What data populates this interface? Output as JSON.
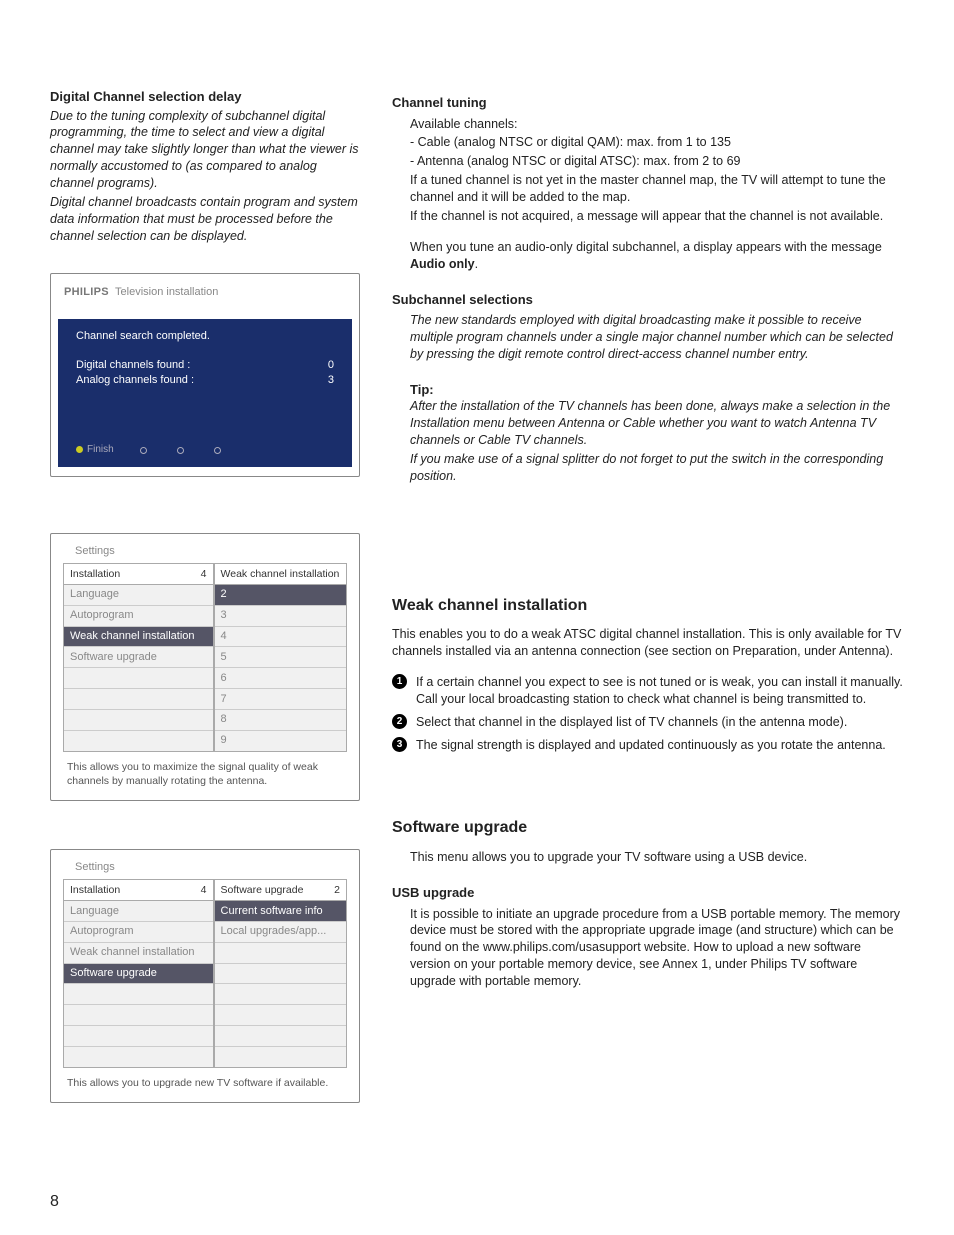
{
  "sidebar_note": {
    "title": "Digital Channel selection delay",
    "p1": "Due to the tuning complexity of subchannel digital programming, the time to select and view a digital channel may take slightly longer than what the viewer is normally accustomed to (as compared to analog channel programs).",
    "p2": "Digital channel broadcasts contain program and system data information that must be processed before the channel selection can be displayed."
  },
  "tv": {
    "brand_bold": "PHILIPS",
    "brand_rest": "Television installation",
    "msg": "Channel search completed.",
    "row1_lbl": "Digital channels found :",
    "row1_val": "0",
    "row2_lbl": "Analog channels found :",
    "row2_val": "3",
    "foot": "Finish"
  },
  "menu1": {
    "title": "Settings",
    "left_head": "Installation",
    "left_num": "4",
    "right_head": "Weak channel installation",
    "left_items": [
      "Language",
      "Autoprogram",
      "Weak channel installation",
      "Software upgrade",
      "",
      "",
      "",
      ""
    ],
    "left_sel_idx": 2,
    "right_items": [
      "2",
      "3",
      "4",
      "5",
      "6",
      "7",
      "8",
      "9"
    ],
    "right_sel_idx": 0,
    "hint": "This allows you to maximize the signal quality of weak channels by manually rotating the antenna."
  },
  "menu2": {
    "title": "Settings",
    "left_head": "Installation",
    "left_num": "4",
    "right_head": "Software upgrade",
    "right_num": "2",
    "left_items": [
      "Language",
      "Autoprogram",
      "Weak channel installation",
      "Software upgrade",
      "",
      "",
      "",
      ""
    ],
    "left_sel_idx": 3,
    "right_items": [
      "Current software info",
      "Local upgrades/app...",
      "",
      "",
      "",
      "",
      "",
      ""
    ],
    "right_sel_idx": 0,
    "hint": "This allows you to upgrade new TV software if available."
  },
  "right": {
    "ct_head": "Channel tuning",
    "ct_lead": "Available channels:",
    "ct_b1": "- Cable (analog NTSC or digital QAM): max. from 1 to 135",
    "ct_b2": "- Antenna (analog NTSC or digital ATSC): max. from 2 to 69",
    "ct_p1": "If a tuned channel is not yet in the master channel map, the TV will attempt to tune the channel and it will be added to the map.",
    "ct_p2": "If the channel is not acquired, a message will appear that the channel is not available.",
    "ct_p3a": "When you tune an audio-only digital subchannel, a display appears with the message ",
    "ct_p3b": "Audio only",
    "ct_p3c": ".",
    "sub_head": "Subchannel selections",
    "sub_p": "The new standards employed with digital broadcasting make it possible to receive multiple program channels under a single major channel number which can be selected by pressing the digit remote control direct-access channel number entry.",
    "tip_head": "Tip:",
    "tip_p1": "After the installation of the TV channels has been done, always make a selection in the Installation menu between Antenna or Cable whether you want to watch Antenna TV channels or Cable TV channels.",
    "tip_p2": "If you make use of a signal splitter do not forget to put the switch in the corresponding position.",
    "weak_head": "Weak channel installation",
    "weak_intro": "This enables you to do a weak ATSC digital channel installation. This is only available for TV channels installed via an antenna connection (see section on Preparation, under Antenna).",
    "weak_1": "If a certain channel you expect to see is not tuned or is weak, you can install it manually. Call your local broadcasting station to check what channel is being transmitted to.",
    "weak_2": "Select that channel in the displayed list of TV channels (in the antenna mode).",
    "weak_3": "The signal strength is displayed and updated continuously as you rotate the antenna.",
    "sw_head": "Software upgrade",
    "sw_intro": "This menu allows you to upgrade your TV software using a USB device.",
    "usb_head": "USB upgrade",
    "usb_p": "It is possible to initiate an upgrade procedure from a USB portable memory. The memory device must be stored with the appropriate upgrade image (and structure) which can be found on the www.philips.com/usasupport website. How to upload a new software version on your portable memory device, see Annex 1, under Philips TV software upgrade with portable memory."
  },
  "page_number": "8"
}
